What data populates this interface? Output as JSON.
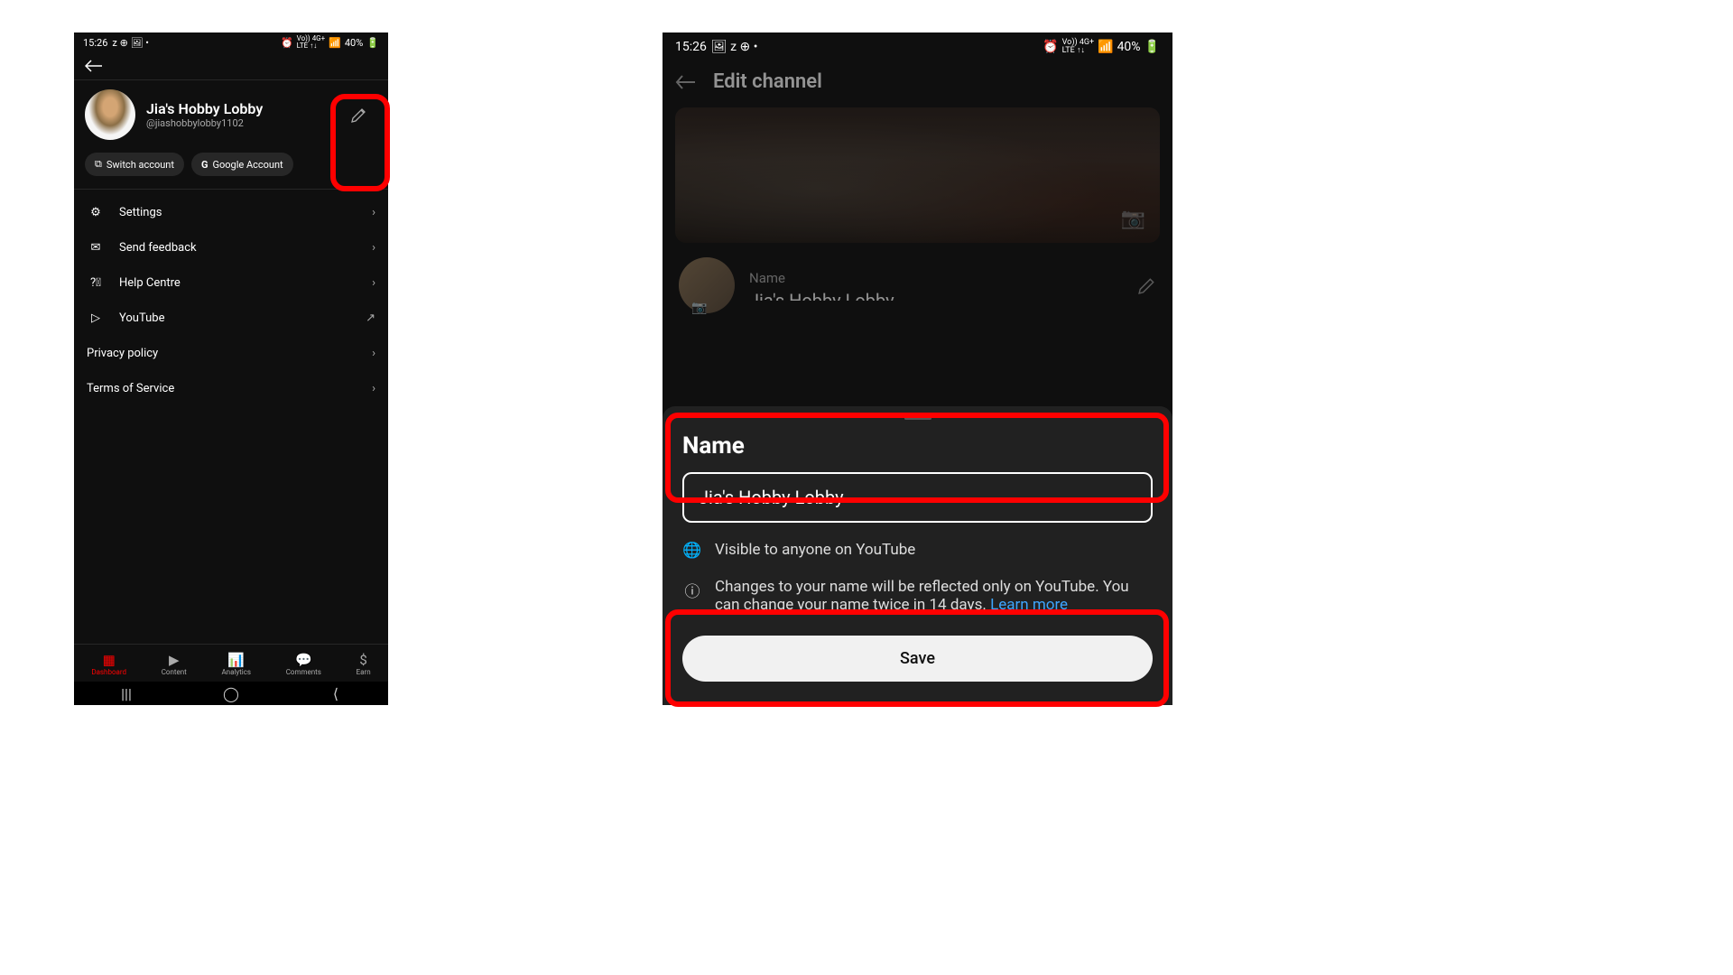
{
  "status": {
    "time": "15:26",
    "indicators": "Z ⊙ 🖼 •",
    "battery": "40%",
    "signal_text": "⏰ ⁴ᴳ⁺ ↑↓ 📶"
  },
  "left": {
    "profile": {
      "name": "Jia's Hobby Lobby",
      "handle": "@jiashobbylobby1102"
    },
    "chips": {
      "switch": "Switch account",
      "google": "Google Account"
    },
    "menu": {
      "settings": "Settings",
      "feedback": "Send feedback",
      "help": "Help Centre",
      "youtube": "YouTube",
      "privacy": "Privacy policy",
      "terms": "Terms of Service"
    },
    "nav": {
      "dashboard": "Dashboard",
      "content": "Content",
      "analytics": "Analytics",
      "comments": "Comments",
      "earn": "Earn"
    }
  },
  "right": {
    "header": "Edit channel",
    "name_label": "Name",
    "sheet": {
      "title": "Name",
      "input_value": "Jia's Hobby Lobby",
      "visibility": "Visible to anyone on YouTube",
      "change_note": "Changes to your name will be reflected only on YouTube. You can change your name twice in 14 days. ",
      "learn_more": "Learn more",
      "save": "Save"
    }
  }
}
